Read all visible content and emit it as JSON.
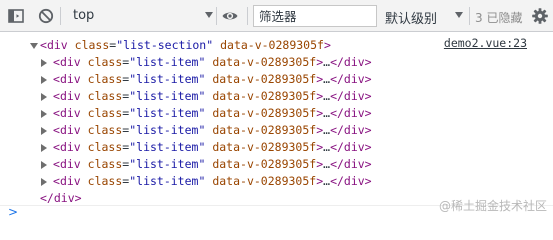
{
  "toolbar": {
    "context": "top",
    "filter_placeholder": "筛选器",
    "levels_label": "默认级别",
    "hidden_count": "3 已隐藏",
    "icons": [
      "sidebar-icon",
      "clear-console-icon",
      "eye-icon",
      "settings-icon"
    ],
    "colors": {
      "background": "#f3f3f3",
      "border": "#cbcdd1"
    }
  },
  "console": {
    "source_link": "demo2.vue:23",
    "parent": {
      "open_tag": "div",
      "class_attr": "class",
      "class_value": "\"list-section\"",
      "data_attr": "data-v-0289305f",
      "close": "</div>"
    },
    "children": [
      {
        "tag": "div",
        "class_value": "\"list-item\"",
        "data_attr": "data-v-0289305f",
        "ellipsis": "…",
        "close": "</div>"
      },
      {
        "tag": "div",
        "class_value": "\"list-item\"",
        "data_attr": "data-v-0289305f",
        "ellipsis": "…",
        "close": "</div>"
      },
      {
        "tag": "div",
        "class_value": "\"list-item\"",
        "data_attr": "data-v-0289305f",
        "ellipsis": "…",
        "close": "</div>"
      },
      {
        "tag": "div",
        "class_value": "\"list-item\"",
        "data_attr": "data-v-0289305f",
        "ellipsis": "…",
        "close": "</div>"
      },
      {
        "tag": "div",
        "class_value": "\"list-item\"",
        "data_attr": "data-v-0289305f",
        "ellipsis": "…",
        "close": "</div>"
      },
      {
        "tag": "div",
        "class_value": "\"list-item\"",
        "data_attr": "data-v-0289305f",
        "ellipsis": "…",
        "close": "</div>"
      },
      {
        "tag": "div",
        "class_value": "\"list-item\"",
        "data_attr": "data-v-0289305f",
        "ellipsis": "…",
        "close": "</div>"
      },
      {
        "tag": "div",
        "class_value": "\"list-item\"",
        "data_attr": "data-v-0289305f",
        "ellipsis": "…",
        "close": "</div>"
      }
    ],
    "prompt": ">",
    "colors": {
      "tag": "#881280",
      "attr": "#994500",
      "attr_value": "#1a1aa6"
    }
  },
  "watermark": "@稀土掘金技术社区"
}
